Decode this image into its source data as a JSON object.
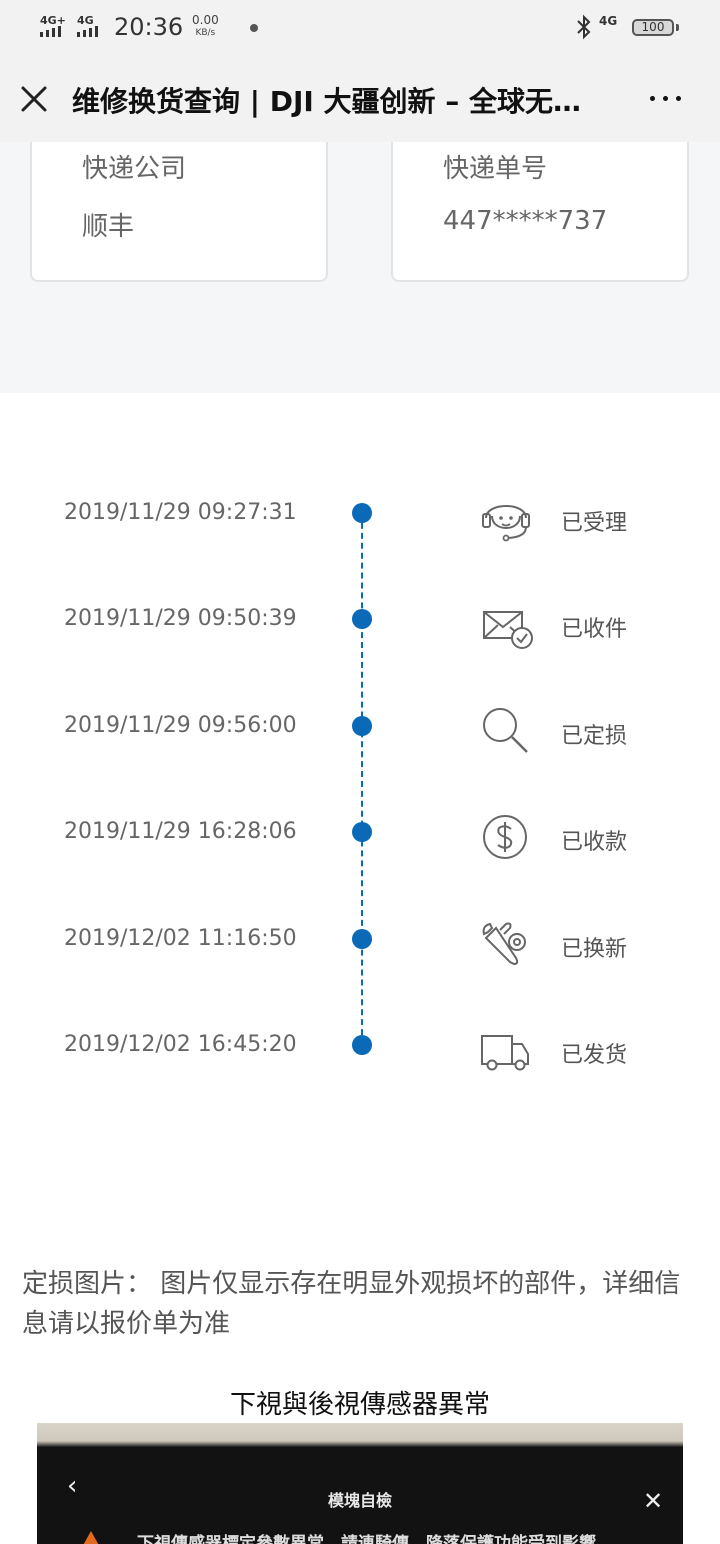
{
  "status_bar": {
    "signal1": "4G+",
    "signal2": "4G",
    "time": "20:36",
    "speed_value": "0.00",
    "speed_unit": "KB/s",
    "signal3": "4G",
    "battery": "100"
  },
  "header": {
    "title": "维修换货查询 | DJI 大疆创新 – 全球无…"
  },
  "shipping": {
    "company_label": "快递公司",
    "company_value": "顺丰",
    "tracking_label": "快递单号",
    "tracking_value": "447*****737"
  },
  "timeline": [
    {
      "time": "2019/11/29 09:27:31",
      "icon": "customer-service-icon",
      "label": "已受理"
    },
    {
      "time": "2019/11/29 09:50:39",
      "icon": "mail-received-icon",
      "label": "已收件"
    },
    {
      "time": "2019/11/29 09:56:00",
      "icon": "magnifier-icon",
      "label": "已定损"
    },
    {
      "time": "2019/11/29 16:28:06",
      "icon": "dollar-icon",
      "label": "已收款"
    },
    {
      "time": "2019/12/02 11:16:50",
      "icon": "repair-tools-icon",
      "label": "已换新"
    },
    {
      "time": "2019/12/02 16:45:20",
      "icon": "delivery-truck-icon",
      "label": "已发货"
    }
  ],
  "colors": {
    "accent": "#0a6ab7"
  },
  "damage": {
    "note": "定损图片： 图片仅显示存在明显外观损坏的部件，详细信息请以报价单为准",
    "caption": "下視與後視傳感器異常",
    "photo_title": "模塊自檢",
    "photo_text": "下視傳感器標定參數異常，請連騎傳，降落保護功能受到影響"
  }
}
